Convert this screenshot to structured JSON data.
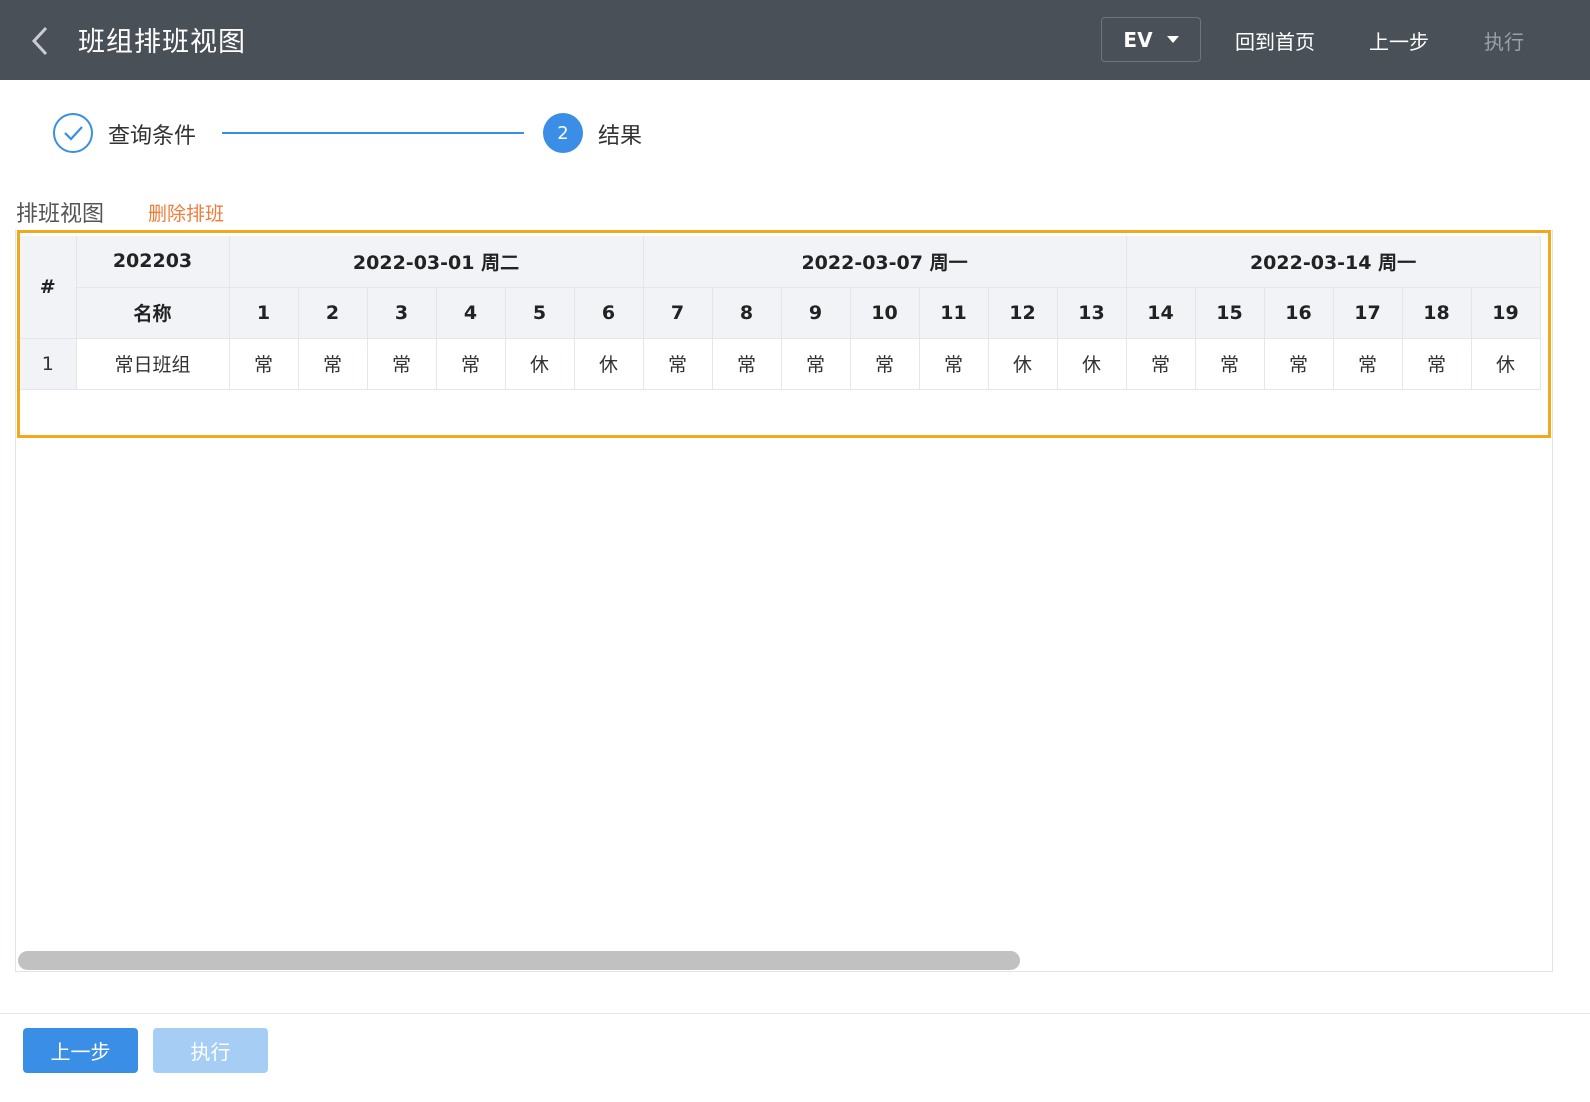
{
  "header": {
    "title": "班组排班视图",
    "org_selector": "EV",
    "home_label": "回到首页",
    "prev_label": "上一步",
    "exec_label": "执行"
  },
  "steps": [
    {
      "label": "查询条件",
      "state": "done"
    },
    {
      "number": "2",
      "label": "结果",
      "state": "active"
    }
  ],
  "section": {
    "title": "排班视图",
    "delete_label": "删除排班"
  },
  "table": {
    "index_header": "#",
    "month": "202203",
    "name_header": "名称",
    "week_groups": [
      {
        "label": "2022-03-01 周二",
        "span": 6
      },
      {
        "label": "2022-03-07 周一",
        "span": 7
      },
      {
        "label": "2022-03-14 周一",
        "span": 6
      }
    ],
    "days": [
      "1",
      "2",
      "3",
      "4",
      "5",
      "6",
      "7",
      "8",
      "9",
      "10",
      "11",
      "12",
      "13",
      "14",
      "15",
      "16",
      "17",
      "18",
      "19"
    ],
    "rows": [
      {
        "index": "1",
        "name": "常日班组",
        "shifts": [
          "常",
          "常",
          "常",
          "常",
          "休",
          "休",
          "常",
          "常",
          "常",
          "常",
          "常",
          "休",
          "休",
          "常",
          "常",
          "常",
          "常",
          "常",
          "休"
        ]
      }
    ]
  },
  "footer": {
    "prev_label": "上一步",
    "exec_label": "执行"
  },
  "colors": {
    "header_bg": "#4a5058",
    "accent": "#3a8ee6",
    "delete_link": "#f07c3a",
    "highlight_border": "#f2a81d"
  }
}
